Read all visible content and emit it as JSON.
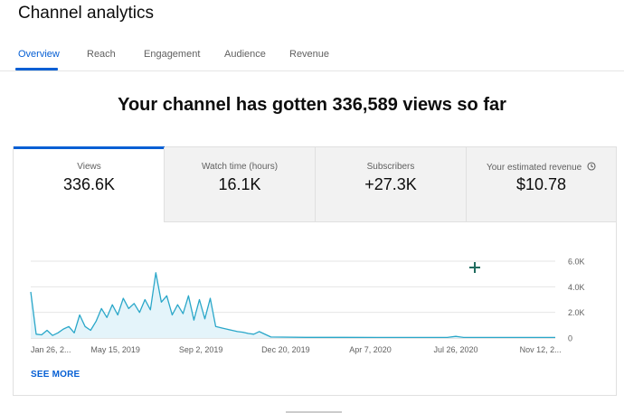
{
  "app": {
    "title": "Channel analytics"
  },
  "tabs": [
    {
      "label": "Overview",
      "active": true
    },
    {
      "label": "Reach"
    },
    {
      "label": "Engagement"
    },
    {
      "label": "Audience"
    },
    {
      "label": "Revenue"
    }
  ],
  "headline": "Your channel has gotten 336,589 views so far",
  "metrics": [
    {
      "label": "Views",
      "value": "336.6K",
      "active": true
    },
    {
      "label": "Watch time (hours)",
      "value": "16.1K"
    },
    {
      "label": "Subscribers",
      "value": "+27.3K"
    },
    {
      "label": "Your estimated revenue",
      "value": "$10.78",
      "icon": "clock-icon"
    }
  ],
  "colors": {
    "accent": "#065fd4",
    "line": "#2aa7c9",
    "area": "#e4f4fa"
  },
  "chart_data": {
    "type": "area",
    "series": [
      {
        "x": [
          "2019-01-26",
          "2019-02-02",
          "2019-02-09",
          "2019-02-16",
          "2019-02-23",
          "2019-03-02",
          "2019-03-09",
          "2019-03-16",
          "2019-03-23",
          "2019-03-30",
          "2019-04-06",
          "2019-04-13",
          "2019-04-20",
          "2019-04-27",
          "2019-05-04",
          "2019-05-11",
          "2019-05-18",
          "2019-05-25",
          "2019-06-01",
          "2019-06-08",
          "2019-06-15",
          "2019-06-22",
          "2019-06-29",
          "2019-07-06",
          "2019-07-13",
          "2019-07-20",
          "2019-07-27",
          "2019-08-03",
          "2019-08-10",
          "2019-08-17",
          "2019-08-24",
          "2019-08-31",
          "2019-09-07",
          "2019-09-14",
          "2019-09-21",
          "2019-09-28",
          "2019-10-05",
          "2019-10-12",
          "2019-10-19",
          "2019-10-26",
          "2019-11-02",
          "2019-11-09",
          "2019-11-16",
          "2019-12-01",
          "2020-01-15",
          "2020-03-01",
          "2020-04-15",
          "2020-06-01",
          "2020-07-15",
          "2020-07-26",
          "2020-08-05",
          "2020-09-15",
          "2020-11-01",
          "2020-12-01"
        ],
        "values": [
          3600,
          300,
          250,
          600,
          200,
          400,
          700,
          900,
          400,
          1800,
          900,
          600,
          1300,
          2300,
          1600,
          2600,
          1800,
          3100,
          2300,
          2700,
          2000,
          3000,
          2200,
          5100,
          2800,
          3300,
          1800,
          2600,
          1900,
          3300,
          1400,
          3000,
          1500,
          3100,
          900,
          800,
          700,
          600,
          500,
          450,
          350,
          300,
          500,
          80,
          50,
          50,
          40,
          40,
          40,
          130,
          40,
          40,
          40,
          40
        ]
      }
    ],
    "x_tick_labels": [
      "Jan 26, 2...",
      "May 15, 2019",
      "Sep 2, 2019",
      "Dec 20, 2019",
      "Apr 7, 2020",
      "Jul 26, 2020",
      "Nov 12, 2..."
    ],
    "x_tick_dates": [
      "2019-01-26",
      "2019-05-15",
      "2019-09-02",
      "2019-12-20",
      "2020-04-07",
      "2020-07-26",
      "2020-11-12"
    ],
    "y_ticks": [
      0,
      2000,
      4000,
      6000
    ],
    "y_tick_labels": [
      "0",
      "2.0K",
      "4.0K",
      "6.0K"
    ],
    "xlim": [
      "2019-01-26",
      "2020-12-01"
    ],
    "ylim": [
      0,
      6000
    ],
    "grid": true,
    "cursor_icon": "crosshair-icon"
  },
  "actions": {
    "see_more": "SEE MORE"
  }
}
